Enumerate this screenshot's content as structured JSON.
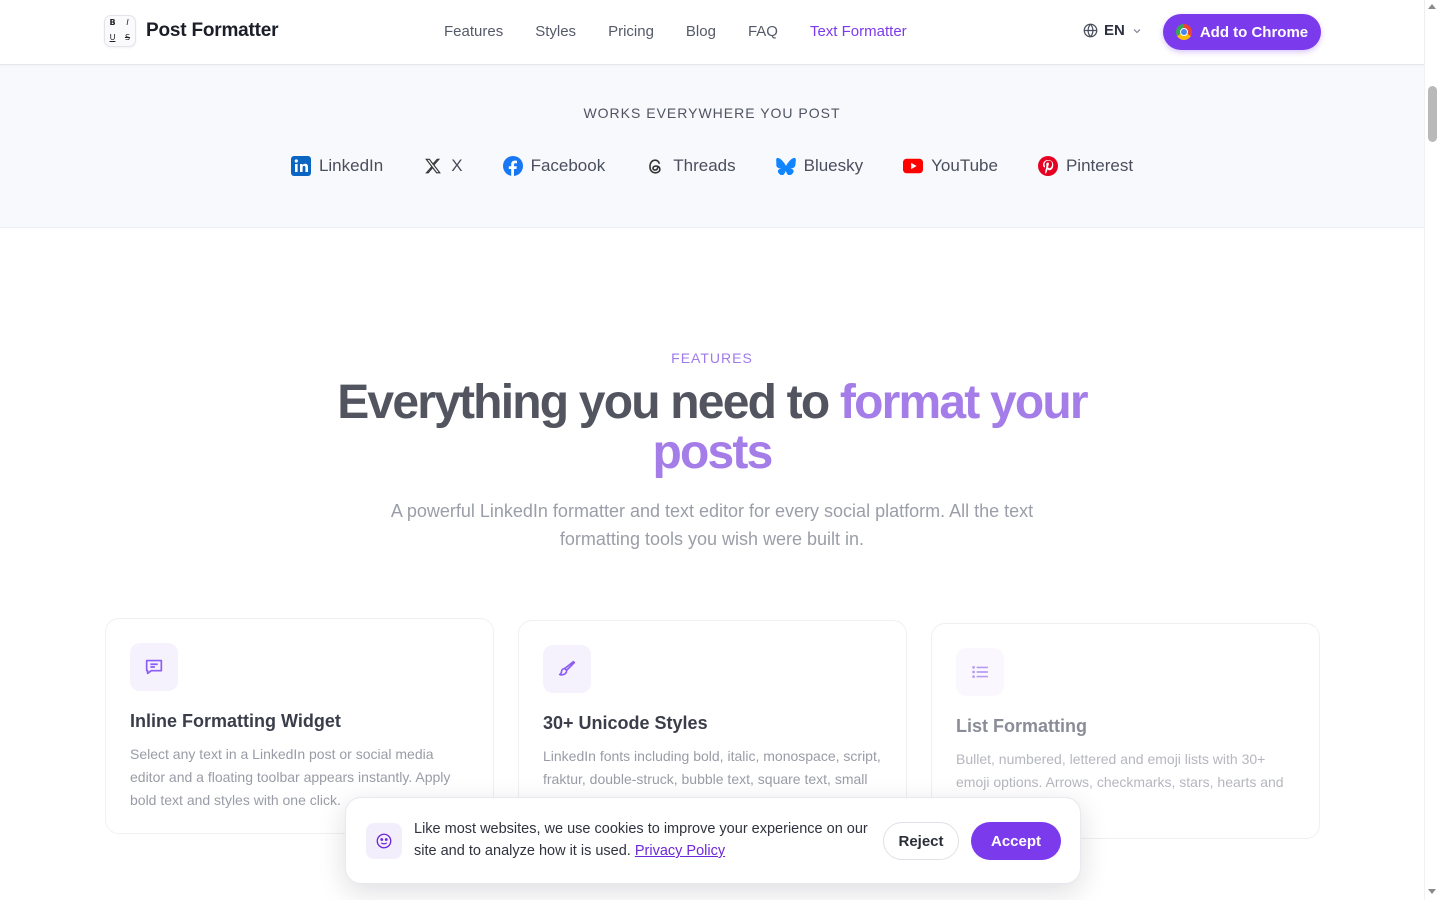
{
  "header": {
    "logo_text": "Post Formatter",
    "logo_letters": [
      "B",
      "I",
      "U",
      "S"
    ],
    "nav": [
      {
        "label": "Features"
      },
      {
        "label": "Styles"
      },
      {
        "label": "Pricing"
      },
      {
        "label": "Blog"
      },
      {
        "label": "FAQ"
      },
      {
        "label": "Text Formatter",
        "accent": true
      }
    ],
    "language": "EN",
    "cta_label": "Add to Chrome"
  },
  "platforms": {
    "title": "WORKS EVERYWHERE YOU POST",
    "items": [
      {
        "label": "LinkedIn",
        "icon": "linkedin-icon",
        "color": "#0a66c2"
      },
      {
        "label": "X",
        "icon": "x-icon",
        "color": "#333333"
      },
      {
        "label": "Facebook",
        "icon": "facebook-icon",
        "color": "#1877f2"
      },
      {
        "label": "Threads",
        "icon": "threads-icon",
        "color": "#333333"
      },
      {
        "label": "Bluesky",
        "icon": "bluesky-icon",
        "color": "#1185fe"
      },
      {
        "label": "YouTube",
        "icon": "youtube-icon",
        "color": "#ff0000"
      },
      {
        "label": "Pinterest",
        "icon": "pinterest-icon",
        "color": "#e60023"
      }
    ]
  },
  "features": {
    "eyebrow": "FEATURES",
    "headline_plain": "Everything you need to ",
    "headline_accent": "format your posts",
    "subhead": "A powerful LinkedIn formatter and text editor for every social platform. All the text formatting tools you wish were built in.",
    "cards": [
      {
        "title": "Inline Formatting Widget",
        "icon": "chat-bubble-icon",
        "text": "Select any text in a LinkedIn post or social media editor and a floating toolbar appears instantly. Apply bold text and styles with one click."
      },
      {
        "title": "30+ Unicode Styles",
        "icon": "paintbrush-icon",
        "text": "LinkedIn fonts including bold, italic, monospace, script, fraktur, double-struck, bubble text, square text, small caps and strikethrough."
      },
      {
        "title": "List Formatting",
        "icon": "list-icon",
        "text": "Bullet, numbered, lettered and emoji lists with 30+ emoji options. Arrows, checkmarks, stars, hearts and more."
      }
    ]
  },
  "cookie": {
    "message": "Like most websites, we use cookies to improve your experience on our site and to analyze how it is used.",
    "link_label": "Privacy Policy",
    "reject_label": "Reject",
    "accept_label": "Accept"
  },
  "colors": {
    "brand": "#7c3aed",
    "accent_text": "#a47de8"
  }
}
